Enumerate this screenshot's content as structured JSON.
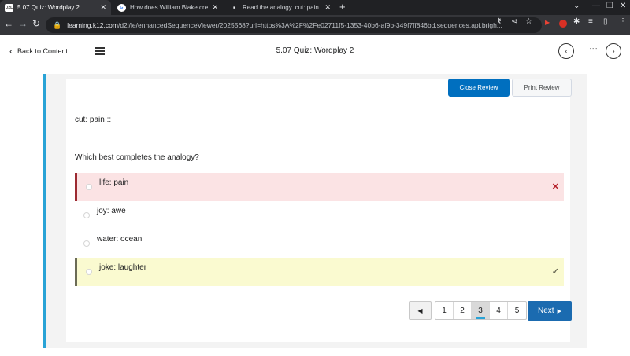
{
  "browser": {
    "tabs": [
      {
        "favicon": "D2L",
        "title": "5.07 Quiz: Wordplay 2",
        "active": true
      },
      {
        "favicon": "G",
        "title": "How does William Blake create",
        "active": false
      },
      {
        "favicon": "■",
        "title": "Read the analogy. cut: pain :: W",
        "active": false
      }
    ],
    "url_host": "learning.k12.com",
    "url_path": "/d2l/le/enhancedSequenceViewer/2025568?url=https%3A%2F%2Fe02711f5-1353-40b6-af9b-349f7ff846bd.sequences.api.brigh..."
  },
  "appbar": {
    "back_label": "Back to Content",
    "title": "5.07 Quiz: Wordplay 2"
  },
  "review": {
    "close_label": "Close Review",
    "print_label": "Print Review"
  },
  "question": {
    "stem": "cut: pain ::",
    "prompt": "Which best completes the analogy?",
    "options": [
      {
        "label": "life: pain",
        "status": "incorrect-selected",
        "mark": "✕"
      },
      {
        "label": "joy: awe",
        "status": "none",
        "mark": ""
      },
      {
        "label": "water: ocean",
        "status": "none",
        "mark": ""
      },
      {
        "label": "joke: laughter",
        "status": "correct",
        "mark": "✓"
      }
    ]
  },
  "pagination": {
    "prev_icon": "◀",
    "pages": [
      "1",
      "2",
      "3",
      "4",
      "5"
    ],
    "current": "3",
    "next_label": "Next",
    "next_icon": "▶"
  },
  "colors": {
    "accent": "#29a3d6",
    "primary_button": "#006fbf",
    "next_button": "#1b6bb0",
    "incorrect_bg": "#fbe3e4",
    "correct_bg": "#fafad0"
  }
}
